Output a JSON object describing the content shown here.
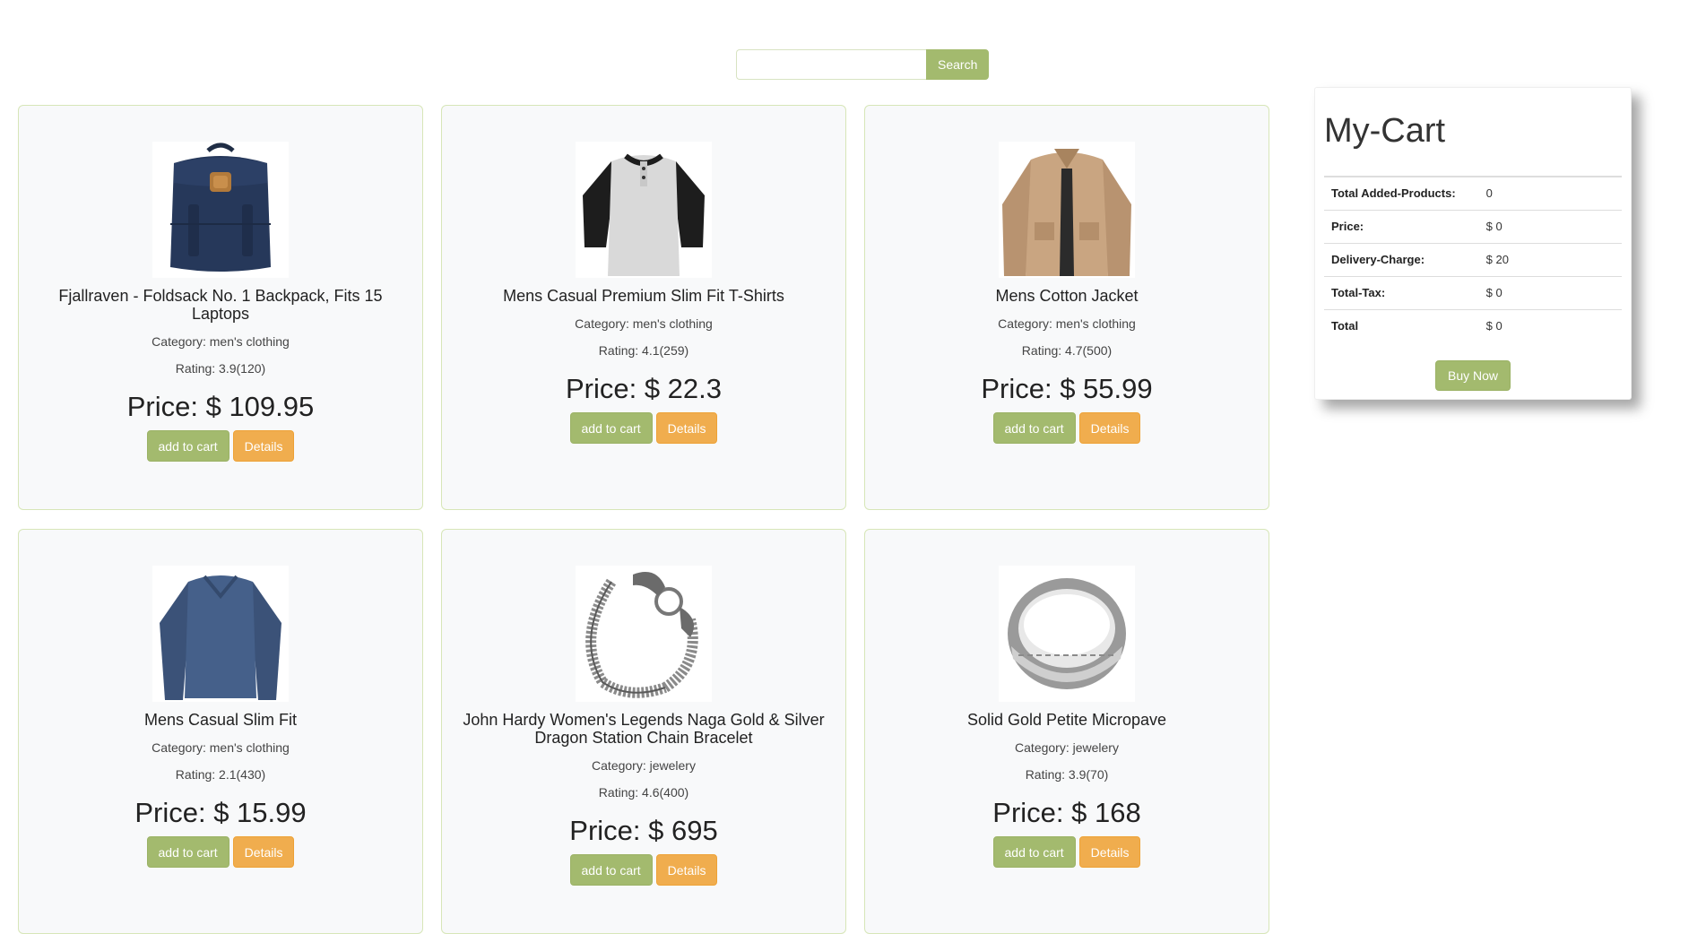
{
  "search": {
    "placeholder": "",
    "value": "",
    "button_label": "Search"
  },
  "products": [
    {
      "title": "Fjallraven - Foldsack No. 1 Backpack, Fits 15 Laptops",
      "category": "Category: men's clothing",
      "rating": "Rating: 3.9(120)",
      "price": "Price: $ 109.95",
      "add_label": "add to cart",
      "details_label": "Details",
      "image": "backpack"
    },
    {
      "title": "Mens Casual Premium Slim Fit T-Shirts",
      "category": "Category: men's clothing",
      "rating": "Rating: 4.1(259)",
      "price": "Price: $ 22.3",
      "add_label": "add to cart",
      "details_label": "Details",
      "image": "raglan-tshirt"
    },
    {
      "title": "Mens Cotton Jacket",
      "category": "Category: men's clothing",
      "rating": "Rating: 4.7(500)",
      "price": "Price: $ 55.99",
      "add_label": "add to cart",
      "details_label": "Details",
      "image": "cotton-jacket"
    },
    {
      "title": "Mens Casual Slim Fit",
      "category": "Category: men's clothing",
      "rating": "Rating: 2.1(430)",
      "price": "Price: $ 15.99",
      "add_label": "add to cart",
      "details_label": "Details",
      "image": "longsleeve-shirt"
    },
    {
      "title": "John Hardy Women's Legends Naga Gold & Silver Dragon Station Chain Bracelet",
      "category": "Category: jewelery",
      "rating": "Rating: 4.6(400)",
      "price": "Price: $ 695",
      "add_label": "add to cart",
      "details_label": "Details",
      "image": "dragon-bracelet"
    },
    {
      "title": "Solid Gold Petite Micropave",
      "category": "Category: jewelery",
      "rating": "Rating: 3.9(70)",
      "price": "Price: $ 168",
      "add_label": "add to cart",
      "details_label": "Details",
      "image": "silver-ring"
    }
  ],
  "cart": {
    "title": "My-Cart",
    "rows": [
      {
        "label": "Total Added-Products:",
        "value": "0"
      },
      {
        "label": "Price:",
        "value": "$ 0"
      },
      {
        "label": "Delivery-Charge:",
        "value": "$ 20"
      },
      {
        "label": "Total-Tax:",
        "value": "$ 0"
      },
      {
        "label": "Total",
        "value": "$ 0"
      }
    ],
    "buy_label": "Buy Now"
  },
  "colors": {
    "primary": "#a3ba6e",
    "warning": "#f0ad4e",
    "card_border": "#d7e6b8",
    "card_bg": "#f8f9fa"
  }
}
